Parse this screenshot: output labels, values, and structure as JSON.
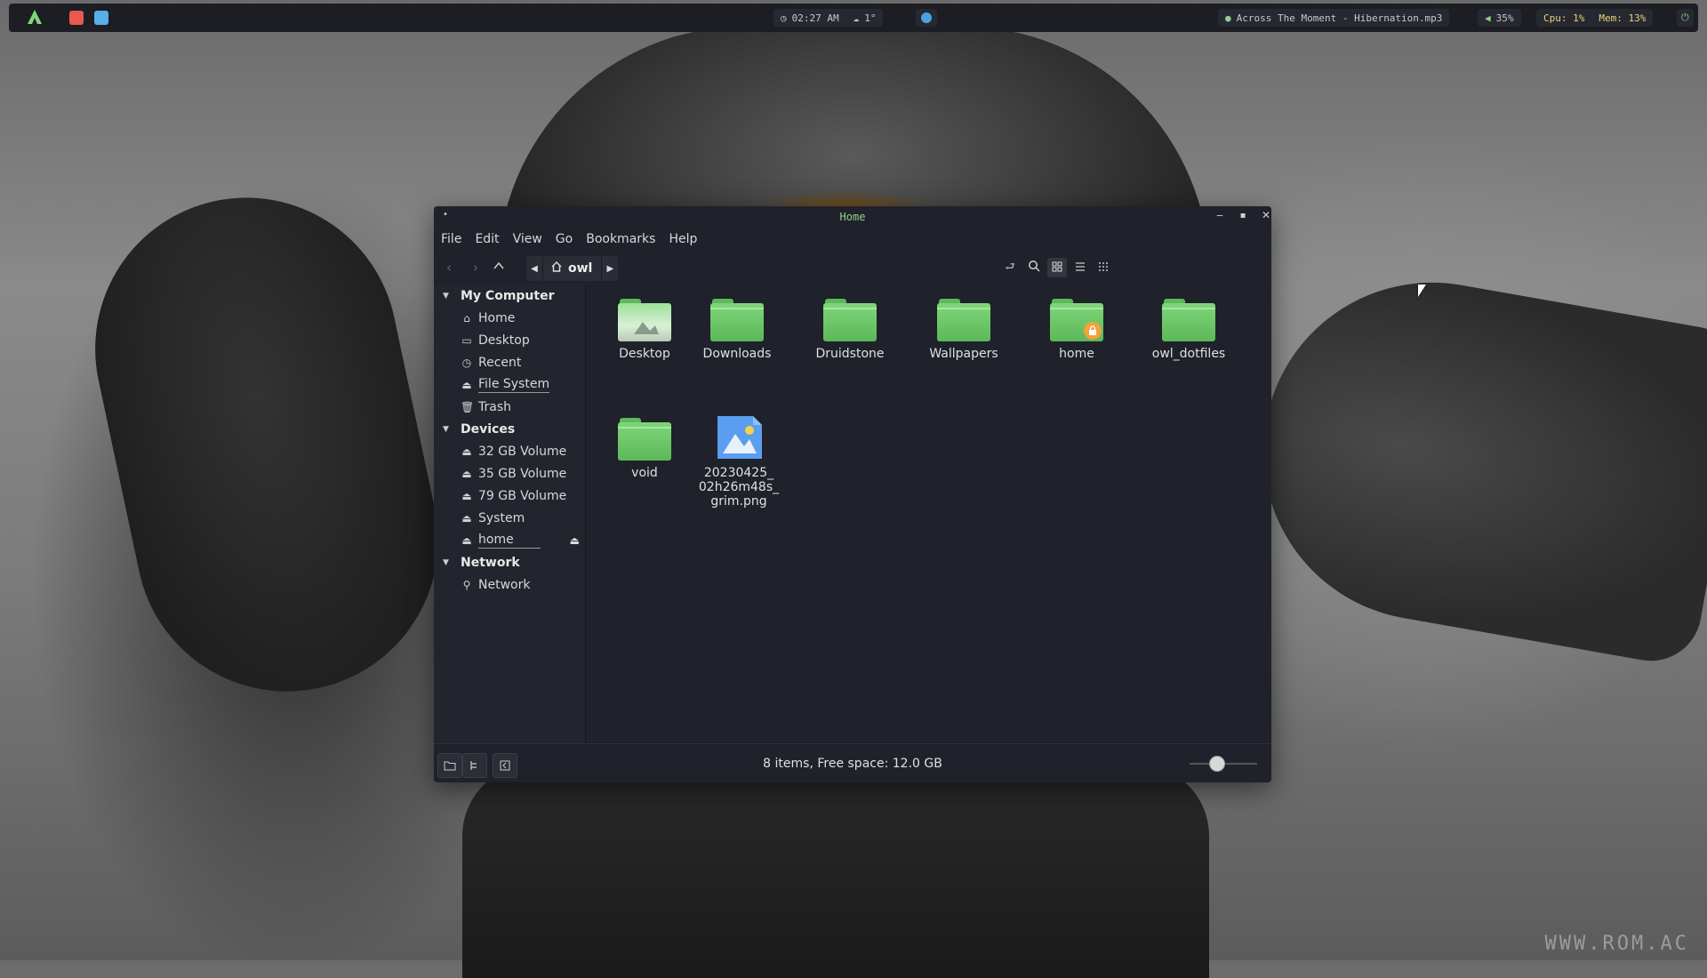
{
  "topbar": {
    "clock": "02:27 AM",
    "weather": "1°",
    "music": "Across The Moment - Hibernation.mp3",
    "volume": "35%",
    "cpu": "Cpu: 1%",
    "mem": "Mem: 13%"
  },
  "window": {
    "title": "Home",
    "menu": [
      "File",
      "Edit",
      "View",
      "Go",
      "Bookmarks",
      "Help"
    ],
    "breadcrumb": "owl"
  },
  "sidebar": {
    "sections": [
      {
        "label": "My Computer",
        "items": [
          "Home",
          "Desktop",
          "Recent",
          "File System",
          "Trash"
        ]
      },
      {
        "label": "Devices",
        "items": [
          "32 GB Volume",
          "35 GB Volume",
          "79 GB Volume",
          "System",
          "home"
        ]
      },
      {
        "label": "Network",
        "items": [
          "Network"
        ]
      }
    ]
  },
  "files": [
    {
      "name": "Desktop",
      "icon": "desktop-folder-icon"
    },
    {
      "name": "Downloads",
      "icon": "folder-icon"
    },
    {
      "name": "Druidstone",
      "icon": "folder-icon"
    },
    {
      "name": "Wallpapers",
      "icon": "folder-icon"
    },
    {
      "name": "home",
      "icon": "locked-folder-icon"
    },
    {
      "name": "owl_dotfiles",
      "icon": "folder-icon"
    },
    {
      "name": "void",
      "icon": "folder-icon"
    },
    {
      "name": "20230425_02h26m48s_grim.png",
      "line1": "20230425_",
      "line2": "02h26m48s_",
      "line3": "grim.png",
      "icon": "image-file-icon"
    }
  ],
  "status": {
    "text": "8 items, Free space: 12.0 GB"
  },
  "colors": {
    "accent": "#8fd18a",
    "folder": "#6cc867",
    "window_bg": "#1f222a"
  },
  "watermark": "WWW.ROM.AC"
}
